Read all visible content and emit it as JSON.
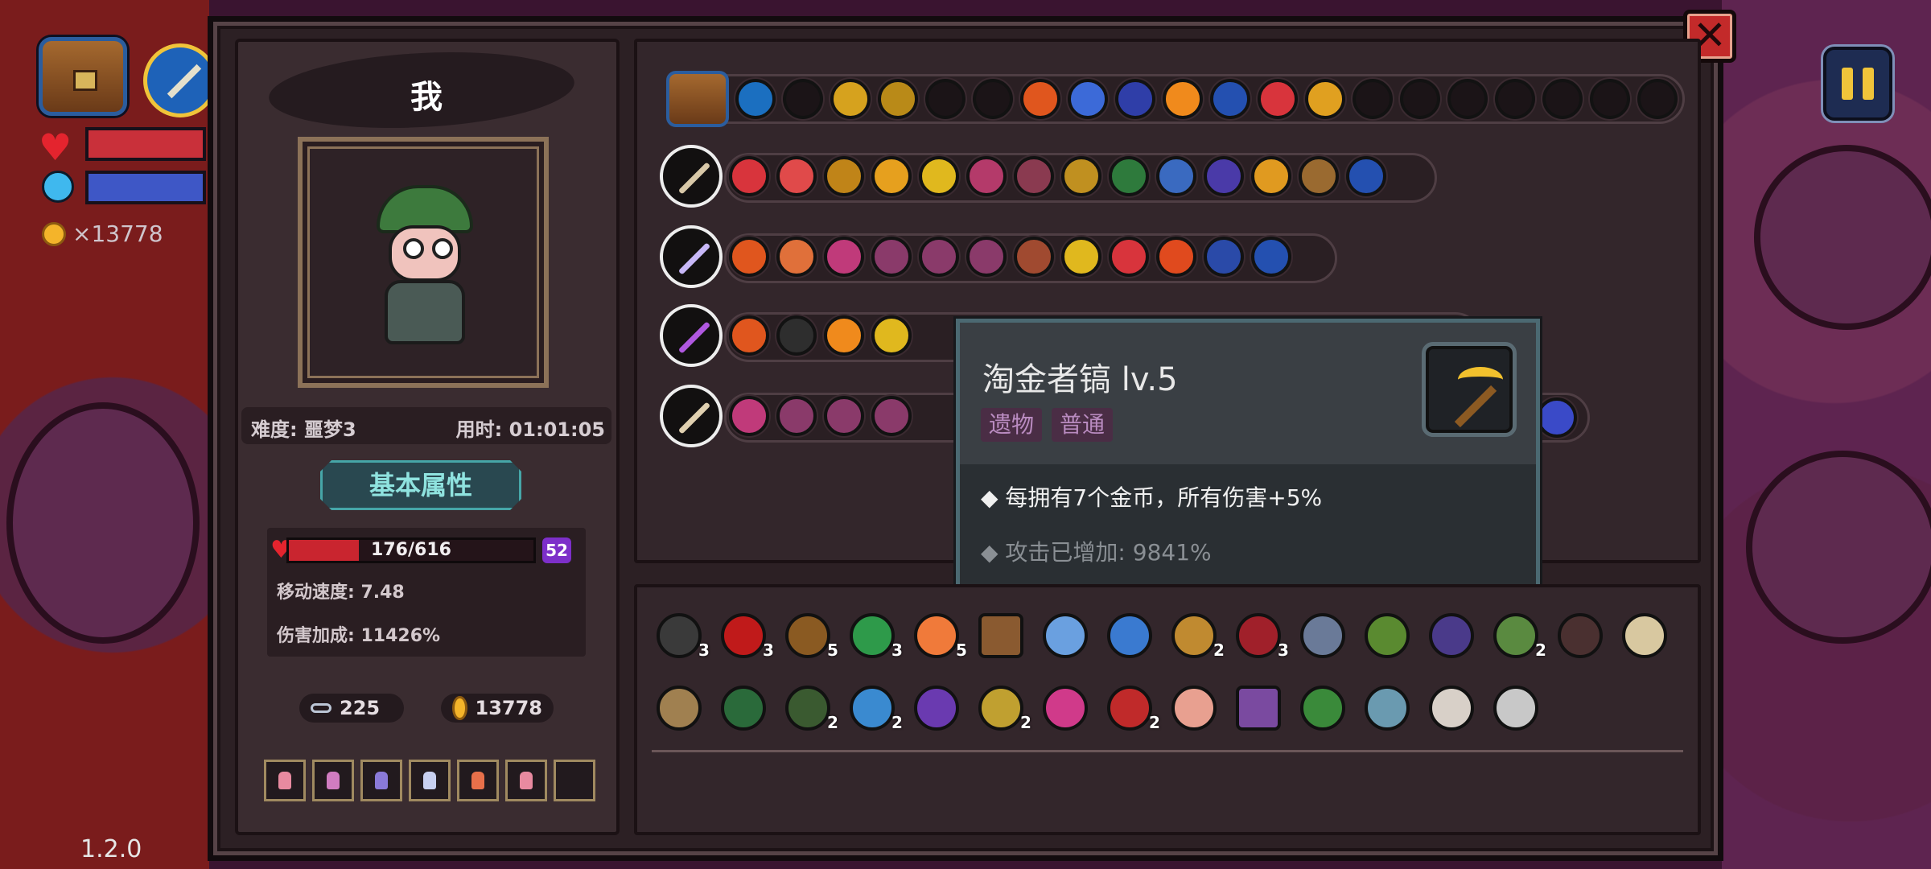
{
  "hud": {
    "gold": "×13778",
    "version": "1.2.0"
  },
  "character": {
    "name": "我",
    "difficulty": "难度: 噩梦3",
    "time": "用时: 01:01:05",
    "basic_attr_button": "基本属性",
    "hp": "176/616",
    "hp_fraction": 0.286,
    "shield": "52",
    "move_speed": "移动速度: 7.48",
    "damage_bonus": "伤害加成: 11426%",
    "keys": "225",
    "gold": "13778"
  },
  "colors": {
    "accent_gold": "#f0c43a",
    "hp_red": "#c9252f",
    "shield_purple": "#7d2fc9",
    "tooltip_border": "#4b6972"
  },
  "tooltip": {
    "title": "淘金者镐 lv.5",
    "tags": [
      "遗物",
      "普通"
    ],
    "icon": "pickaxe-icon",
    "effect": "◆ 每拥有7个金币，所有伤害+5%",
    "bonus": "◆ 攻击已增加: 9841%"
  },
  "inventory_row1_counts": [
    "3",
    "3",
    "5",
    "3",
    "5",
    "",
    "",
    "",
    "2",
    "3",
    "",
    "",
    "",
    "2",
    "",
    ""
  ],
  "inventory_row2_counts": [
    "",
    "",
    "2",
    "2",
    "",
    "2",
    "",
    "2",
    "",
    "",
    "",
    "",
    "",
    ""
  ]
}
